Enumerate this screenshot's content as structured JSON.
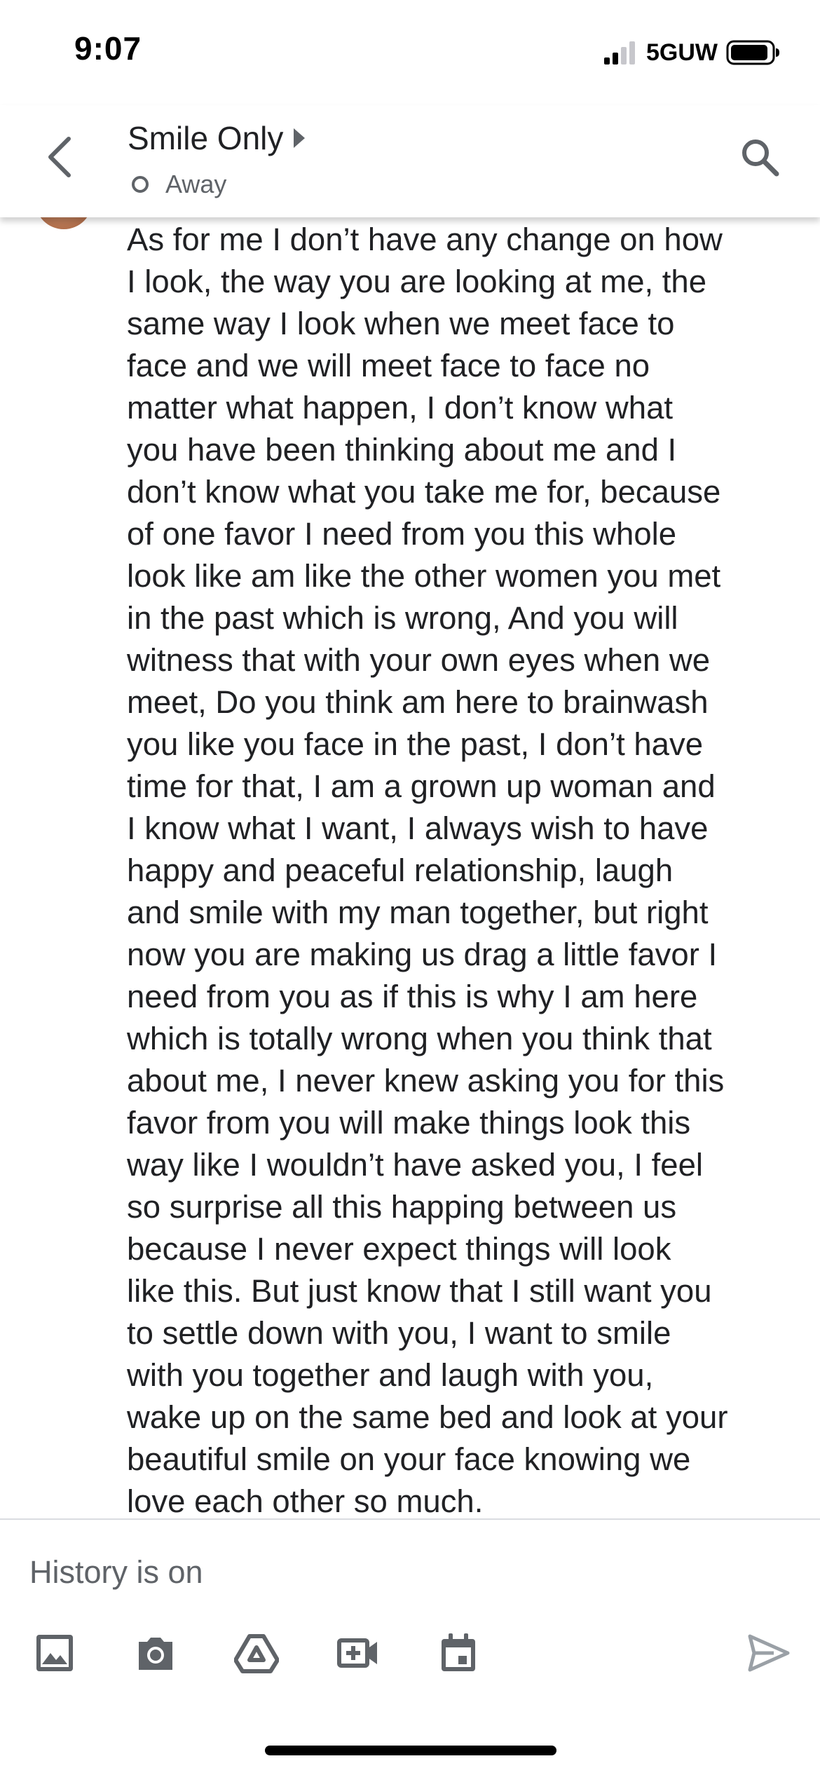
{
  "status_bar": {
    "time": "9:07",
    "network": "5GUW",
    "icons": [
      "signal-icon",
      "battery-icon"
    ]
  },
  "header": {
    "contact_name": "Smile Only",
    "presence": "Away",
    "icons": [
      "back-arrow-icon",
      "caret-right-icon",
      "presence-ring-icon",
      "search-icon"
    ]
  },
  "message": {
    "text": "As for me I don’t have any change on how\nI look, the way you are looking at me, the\nsame way I look when we meet face to\nface and we will meet face to face no\nmatter what happen, I don’t know what\nyou have been thinking about me and I\ndon’t know what you take me for, because\nof one favor I need from you this whole\nlook like am like the other women you met\nin the past which is wrong, And you will\nwitness that with your own eyes when we\nmeet, Do you think am here to brainwash\nyou like you face in the past, I don’t have\ntime for that, I am a grown up woman and\nI know what I want, I always wish to have\nhappy and peaceful relationship, laugh\nand smile with my man together, but right\nnow you are making us drag a little favor I\nneed from you as if this is why I am here\nwhich is totally wrong when you think that\nabout me, I never knew asking you for this\nfavor from you will make things look this\nway like I wouldn’t have asked you, I feel\nso surprise all this happing between us\nbecause I never expect things will look\nlike this. But just know that I still want you\nto settle down with you, I want to smile\nwith you together and laugh with you,\nwake up on the same bed and look at your\nbeautiful smile on your face knowing we\nlove each other so much."
  },
  "compose": {
    "placeholder": "History is on",
    "value": ""
  },
  "toolbar": {
    "icons": [
      "image-icon",
      "camera-icon",
      "drive-icon",
      "video-call-icon",
      "calendar-icon",
      "send-icon"
    ]
  },
  "colors": {
    "icon_gray": "#5f6368",
    "send_disabled": "#9aa0a6",
    "divider": "#dadce0",
    "text": "#202124"
  }
}
